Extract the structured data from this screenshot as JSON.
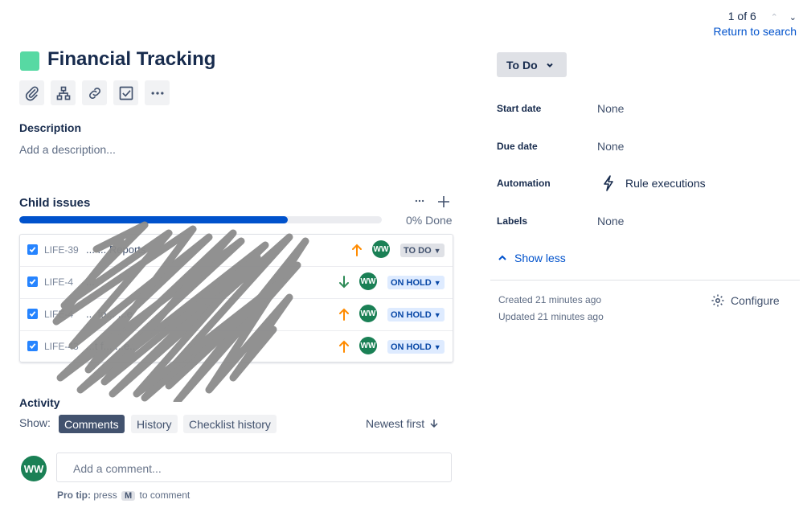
{
  "pager": {
    "count": "1 of 6",
    "return_label": "Return to search"
  },
  "issue": {
    "title": "Financial Tracking"
  },
  "toolbar": [
    "paperclip-icon",
    "hierarchy-icon",
    "link-icon",
    "checklist-icon",
    "more-icon"
  ],
  "description": {
    "heading": "Description",
    "placeholder": "Add a description..."
  },
  "child_issues": {
    "heading": "Child issues",
    "progress_label": "0% Done",
    "progress_fraction": 0.74,
    "rows": [
      {
        "key": "LIFE-39",
        "summary": "... ... Reports",
        "priority": "up",
        "avatar": "WW",
        "status": "TO DO"
      },
      {
        "key": "LIFE-4",
        "summary": "...",
        "priority": "down",
        "avatar": "WW",
        "status": "ON HOLD"
      },
      {
        "key": "LIFE-4",
        "summary": "... fo... ...e",
        "priority": "up",
        "avatar": "WW",
        "status": "ON HOLD"
      },
      {
        "key": "LIFE-43",
        "summary": "...t f... ...e...",
        "priority": "up",
        "avatar": "WW",
        "status": "ON HOLD"
      }
    ]
  },
  "activity": {
    "heading": "Activity",
    "show_label": "Show:",
    "filters": [
      "Comments",
      "History",
      "Checklist history"
    ],
    "active_filter": "Comments",
    "sort_label": "Newest first",
    "comment_avatar": "WW",
    "comment_placeholder": "Add a comment...",
    "protip_bold": "Pro tip:",
    "protip_press": "press",
    "protip_key": "M",
    "protip_suffix": "to comment"
  },
  "sidebar": {
    "status_button": "To Do",
    "fields": [
      {
        "label": "Start date",
        "value": "None"
      },
      {
        "label": "Due date",
        "value": "None"
      },
      {
        "label": "Automation",
        "value": "Rule executions"
      },
      {
        "label": "Labels",
        "value": "None"
      }
    ],
    "show_less": "Show less",
    "created": "Created 21 minutes ago",
    "updated": "Updated 21 minutes ago",
    "configure": "Configure"
  },
  "colors": {
    "accent": "#0052cc",
    "issue_icon": "#57d9a3",
    "avatar": "#1a8055",
    "priority_up": "#ff8b00",
    "priority_down": "#2e8b57"
  }
}
